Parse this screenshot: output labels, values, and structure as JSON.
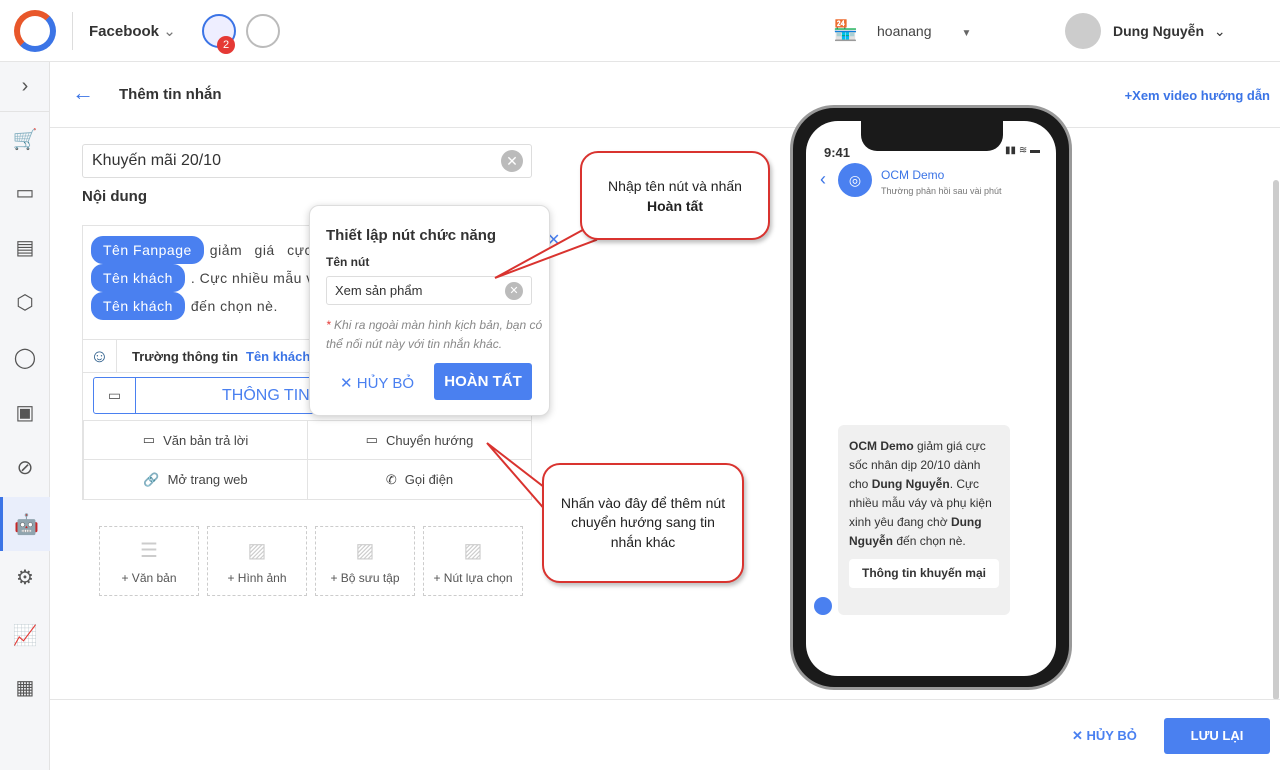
{
  "topbar": {
    "channel": "Facebook",
    "badge_count": "2",
    "store": "hoanang",
    "user": "Dung Nguyễn"
  },
  "header": {
    "title": "Thêm tin nhắn",
    "video_link": "Xem video hướng dẫn"
  },
  "form": {
    "name_value": "Khuyến mãi 20/10",
    "content_label": "Nội dung",
    "message": {
      "chip1": "Tên Fanpage",
      "t1": "giảm giá cực",
      "chip2": "Tên khách",
      "t2": ". Cực nhiều mẫu vá",
      "chip3": "Tên khách",
      "t3": "đến chọn nè."
    },
    "field_label": "Trường thông tin",
    "field_value": "Tên khách",
    "button_label": "THÔNG TIN K",
    "actions": [
      "Văn bản trả lời",
      "Chuyển hướng",
      "Mở trang web",
      "Gọi điện"
    ],
    "add_items": [
      "+ Văn bản",
      "+ Hình ảnh",
      "+ Bộ sưu tập",
      "+ Nút lựa chọn"
    ]
  },
  "popup": {
    "title": "Thiết lập nút chức năng",
    "field_label": "Tên nút",
    "field_value": "Xem sản phẩm",
    "note": "Khi ra ngoài màn hình kịch bản, bạn có thể nối nút này với tin nhắn khác.",
    "cancel": "HỦY BỎ",
    "done": "HOÀN TẤT"
  },
  "callouts": {
    "c1a": "Nhập tên nút và nhấn",
    "c1b": "Hoàn tất",
    "c2": "Nhấn vào đây để thêm nút chuyển hướng sang tin nhắn khác"
  },
  "phone": {
    "time": "9:41",
    "page_name": "OCM Demo",
    "status": "Thường phản hồi sau vài phút",
    "bubble": {
      "b1": "OCM Demo",
      "t1": " giảm giá cực sốc nhân dịp 20/10 dành cho ",
      "b2": "Dung Nguyễn",
      "t2": ". Cực nhiều mẫu váy và phụ kiện xinh yêu đang chờ ",
      "b3": "Dung Nguyễn",
      "t3": " đến chọn nè."
    },
    "button": "Thông tin khuyến mại"
  },
  "footer": {
    "cancel": "HỦY BỎ",
    "save": "LƯU LẠI"
  },
  "colors": {
    "accent": "#4a80f0",
    "callout_border": "#d9332f"
  }
}
